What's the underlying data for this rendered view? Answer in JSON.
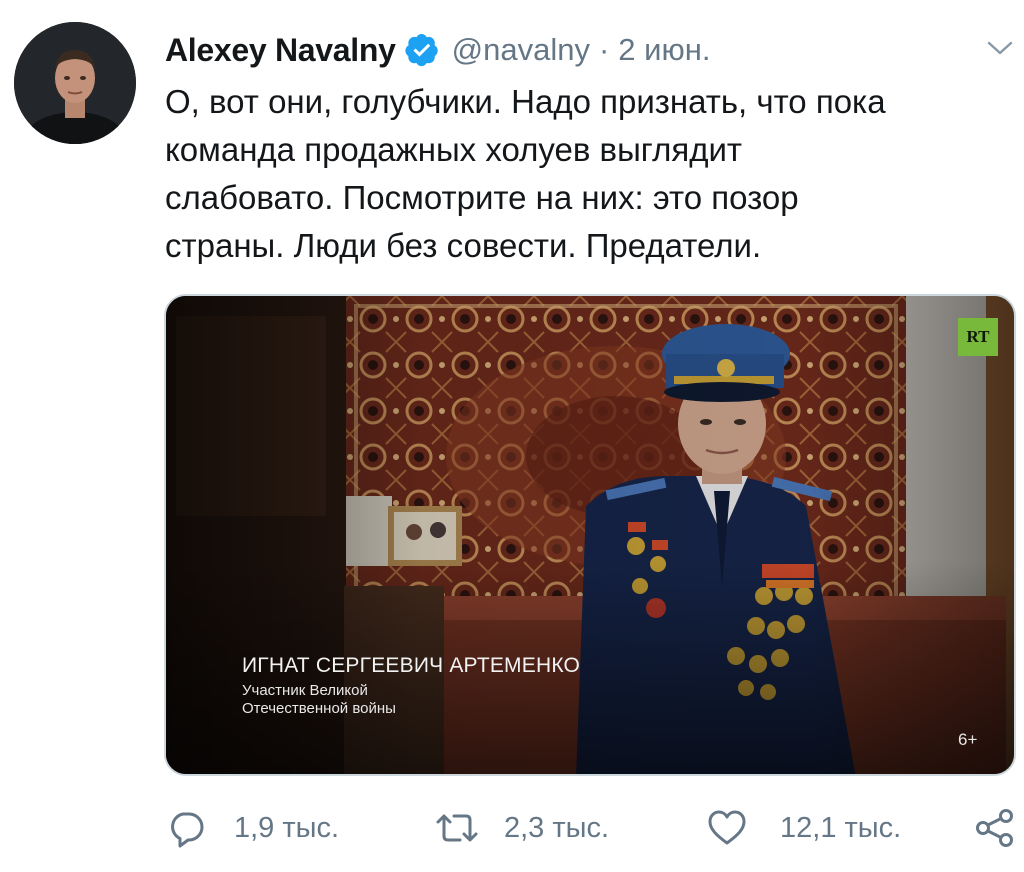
{
  "tweet": {
    "author": {
      "display_name": "Alexey Navalny",
      "handle": "@navalny",
      "verified": true
    },
    "separator": "·",
    "date": "2 июн.",
    "text": "О, вот они, голубчики. Надо признать, что пока\nкоманда продажных холуев выглядит\nслабовато. Посмотрите на них: это позор\nстраны. Люди без совести. Предатели."
  },
  "media": {
    "channel_logo": "RT",
    "caption_name": "ИГНАТ СЕРГЕЕВИЧ АРТЕМЕНКО",
    "caption_subtitle": "Участник Великой\nОтечественной войны",
    "age_rating": "6+"
  },
  "actions": {
    "reply": {
      "icon": "reply-icon",
      "count": "1,9 тыс."
    },
    "retweet": {
      "icon": "retweet-icon",
      "count": "2,3 тыс."
    },
    "like": {
      "icon": "like-icon",
      "count": "12,1 тыс."
    },
    "share": {
      "icon": "share-icon"
    }
  },
  "colors": {
    "verified_blue": "#1da1f2",
    "secondary_text": "#657786",
    "rt_logo_green": "#78b83a"
  }
}
